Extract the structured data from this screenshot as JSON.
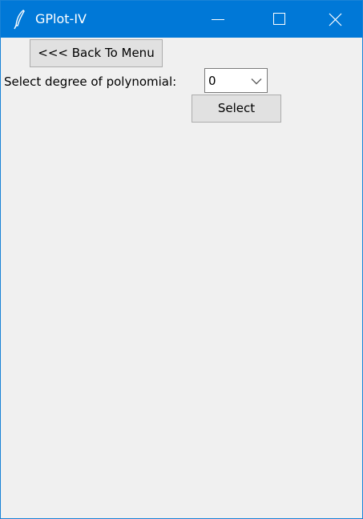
{
  "window": {
    "title": "GPlot-IV",
    "titlebar_color": "#0078d7",
    "background_color": "#f0f0f0",
    "icons": {
      "app": "feather-icon",
      "minimize": "minimize-icon",
      "maximize": "maximize-icon",
      "close": "close-icon"
    }
  },
  "form": {
    "back_button_label": "<<< Back To Menu",
    "degree_label": "Select degree of polynomial:",
    "degree_value": "0",
    "select_button_label": "Select"
  }
}
